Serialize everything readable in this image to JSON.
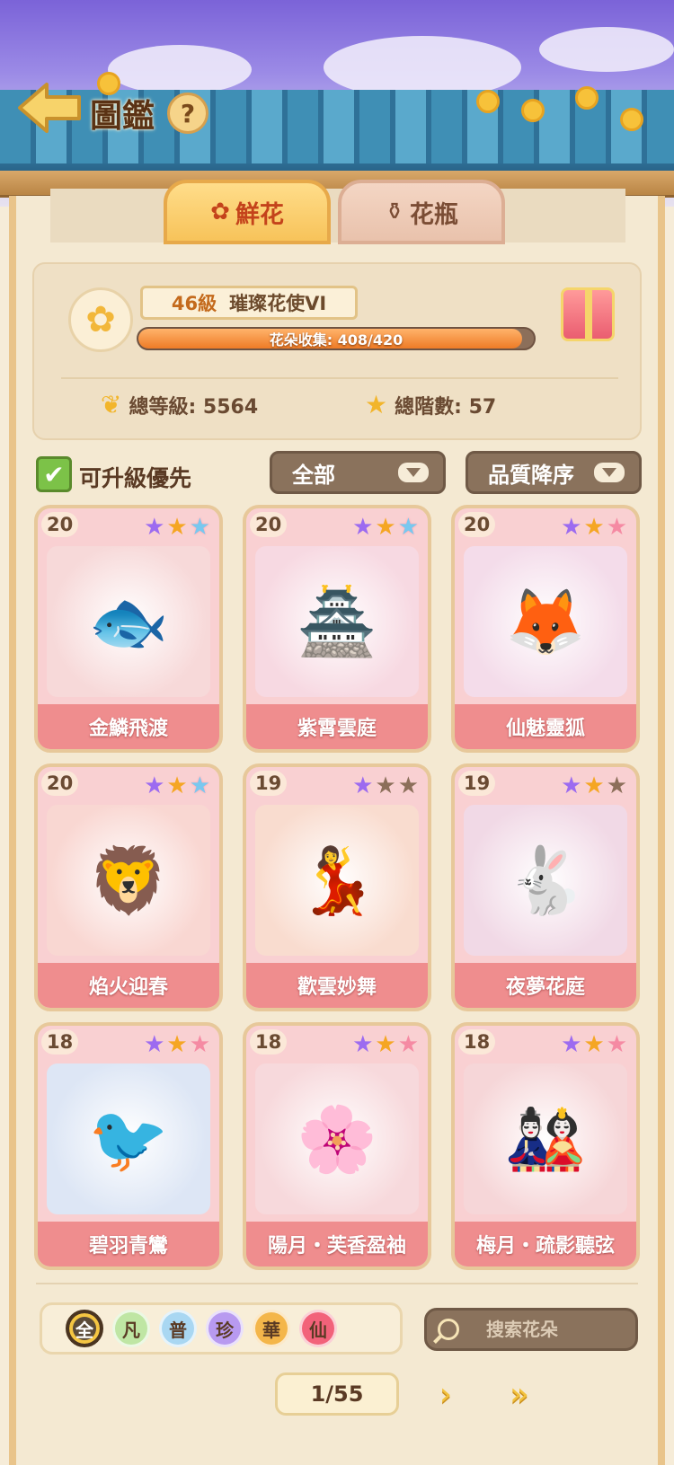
{
  "header": {
    "title": "圖鑑",
    "help_label": "?"
  },
  "tabs": [
    {
      "label": "鮮花",
      "icon": "rose-icon",
      "active": true
    },
    {
      "label": "花瓶",
      "icon": "vase-icon",
      "active": false
    }
  ],
  "profile": {
    "level": "46級",
    "title": "璀璨花使VI",
    "progress_text": "花朵收集: 408/420",
    "progress_fraction": 0.9714,
    "total_level": "總等級: 5564",
    "total_tiers": "總階數: 57"
  },
  "filters": {
    "upgrade_first_label": "可升級優先",
    "upgrade_first_checked": true,
    "category": "全部",
    "sort": "品質降序"
  },
  "cards": [
    {
      "level": "20",
      "name": "金鱗飛渡",
      "stars": [
        "purple",
        "gold",
        "rainbow"
      ],
      "art_color": "#f7d9d9",
      "emoji": "🐟"
    },
    {
      "level": "20",
      "name": "紫霄雲庭",
      "stars": [
        "purple",
        "gold",
        "rainbow"
      ],
      "art_color": "#f7d9e2",
      "emoji": "🏯"
    },
    {
      "level": "20",
      "name": "仙魅靈狐",
      "stars": [
        "purple",
        "gold",
        "pink"
      ],
      "art_color": "#f4dcea",
      "emoji": "🦊"
    },
    {
      "level": "20",
      "name": "焰火迎春",
      "stars": [
        "purple",
        "gold",
        "rainbow"
      ],
      "art_color": "#f9d7d2",
      "emoji": "🦁"
    },
    {
      "level": "19",
      "name": "歡雲妙舞",
      "stars": [
        "purple",
        "gray",
        "gray"
      ],
      "art_color": "#f9dccf",
      "emoji": "💃"
    },
    {
      "level": "19",
      "name": "夜夢花庭",
      "stars": [
        "purple",
        "gold",
        "gray"
      ],
      "art_color": "#f1d9e6",
      "emoji": "🐇"
    },
    {
      "level": "18",
      "name": "碧羽青鸞",
      "stars": [
        "purple",
        "gold",
        "pink"
      ],
      "art_color": "#dde6f5",
      "emoji": "🐦"
    },
    {
      "level": "18",
      "name": "陽月・芙香盈袖",
      "stars": [
        "purple",
        "gold",
        "pink"
      ],
      "art_color": "#f7d9dc",
      "emoji": "🌸"
    },
    {
      "level": "18",
      "name": "梅月・疏影聽弦",
      "stars": [
        "purple",
        "gold",
        "pink"
      ],
      "art_color": "#f6d6d8",
      "emoji": "🎎"
    }
  ],
  "quality_filters": [
    {
      "label": "全",
      "color": "#f4c542",
      "selected": true
    },
    {
      "label": "凡",
      "color": "#bfe6a4",
      "selected": false
    },
    {
      "label": "普",
      "color": "#a9d7f2",
      "selected": false
    },
    {
      "label": "珍",
      "color": "#b89af0",
      "selected": false
    },
    {
      "label": "華",
      "color": "#f4b64a",
      "selected": false
    },
    {
      "label": "仙",
      "color": "#f2627a",
      "selected": false
    }
  ],
  "search": {
    "placeholder": "搜索花朵"
  },
  "pagination": {
    "text": "1/55",
    "next_label": "›",
    "last_label": "»"
  }
}
